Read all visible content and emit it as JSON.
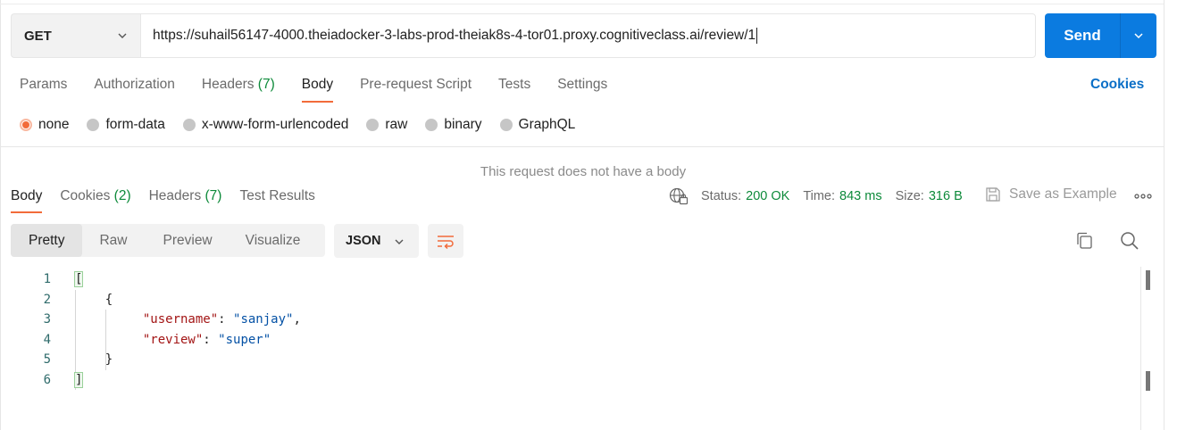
{
  "request": {
    "method": "GET",
    "url": "https://suhail56147-4000.theiadocker-3-labs-prod-theiak8s-4-tor01.proxy.cognitiveclass.ai/review/1",
    "send_label": "Send"
  },
  "request_tabs": {
    "params": "Params",
    "authorization": "Authorization",
    "headers": "Headers",
    "headers_count": "(7)",
    "body": "Body",
    "prerequest": "Pre-request Script",
    "tests": "Tests",
    "settings": "Settings",
    "cookies": "Cookies"
  },
  "body_types": {
    "selected": "none",
    "none": "none",
    "form_data": "form-data",
    "urlencoded": "x-www-form-urlencoded",
    "raw": "raw",
    "binary": "binary",
    "graphql": "GraphQL"
  },
  "no_body_message": "This request does not have a body",
  "response_tabs": {
    "body": "Body",
    "cookies": "Cookies",
    "cookies_count": "(2)",
    "headers": "Headers",
    "headers_count": "(7)",
    "test_results": "Test Results"
  },
  "response_status": {
    "status_label": "Status:",
    "status_value": "200 OK",
    "time_label": "Time:",
    "time_value": "843 ms",
    "size_label": "Size:",
    "size_value": "316 B",
    "save_example": "Save as Example"
  },
  "view_modes": {
    "pretty": "Pretty",
    "raw": "Raw",
    "preview": "Preview",
    "visualize": "Visualize",
    "format": "JSON"
  },
  "colors": {
    "accent": "#f26b3a",
    "send": "#0b7be0",
    "success": "#0d8a3a",
    "link": "#0b6fc7"
  },
  "code": {
    "line_numbers": [
      "1",
      "2",
      "3",
      "4",
      "5",
      "6"
    ],
    "open_bracket": "[",
    "open_brace": "{",
    "key1": "\"username\"",
    "val1": "\"sanjay\"",
    "key2": "\"review\"",
    "val2": "\"super\"",
    "close_brace": "}",
    "close_bracket": "]"
  }
}
